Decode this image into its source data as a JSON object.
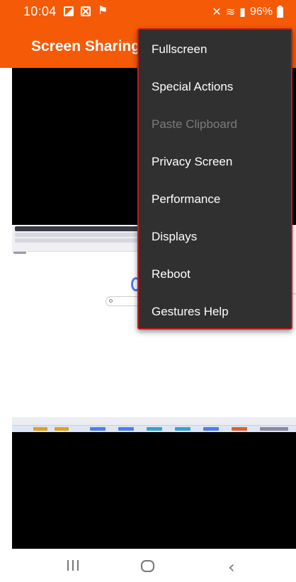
{
  "status_bar": {
    "time": "10:04",
    "battery": "96%",
    "left_icons": [
      "gallery-icon",
      "close-box-icon",
      "flag-icon"
    ],
    "right_icons": [
      "mute-icon",
      "wifi-icon",
      "signal-icon",
      "battery-icon"
    ]
  },
  "app_bar": {
    "title": "Screen Sharing",
    "color": "#f55a07"
  },
  "menu": {
    "items": [
      {
        "label": "Fullscreen",
        "enabled": true
      },
      {
        "label": "Special Actions",
        "enabled": true
      },
      {
        "label": "Paste Clipboard",
        "enabled": false
      },
      {
        "label": "Privacy Screen",
        "enabled": true
      },
      {
        "label": "Performance",
        "enabled": true
      },
      {
        "label": "Displays",
        "enabled": true
      },
      {
        "label": "Reboot",
        "enabled": true
      },
      {
        "label": "Gestures Help",
        "enabled": true
      }
    ]
  },
  "nav_bar": {
    "buttons": [
      "recents-icon",
      "home-icon",
      "back-icon"
    ],
    "back_glyph": "‹"
  }
}
